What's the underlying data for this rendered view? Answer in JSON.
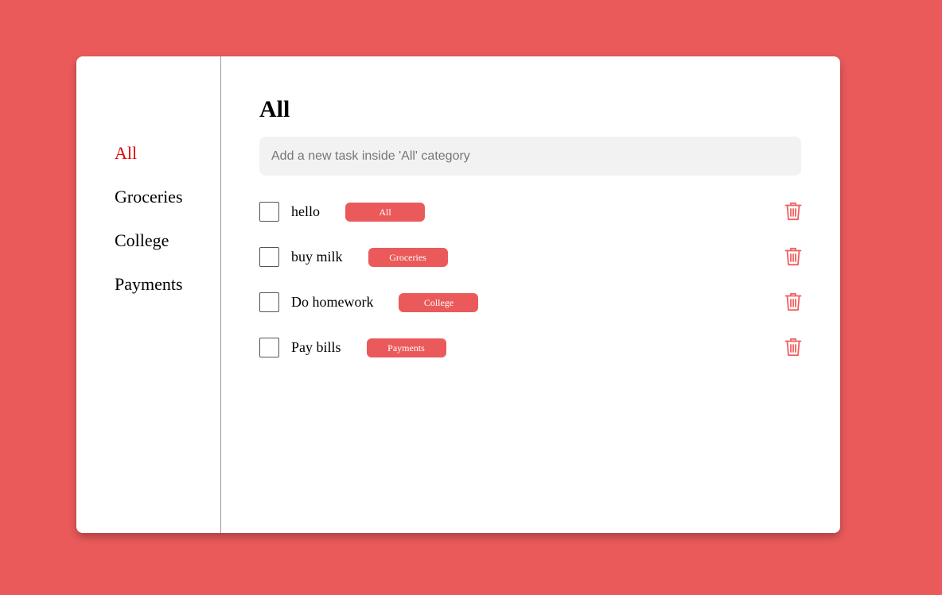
{
  "sidebar": {
    "items": [
      {
        "label": "All"
      },
      {
        "label": "Groceries"
      },
      {
        "label": "College"
      },
      {
        "label": "Payments"
      }
    ]
  },
  "main": {
    "title": "All",
    "input_placeholder": "Add a new task inside 'All' category",
    "tasks": [
      {
        "text": "hello",
        "category": "All"
      },
      {
        "text": "buy milk",
        "category": "Groceries"
      },
      {
        "text": "Do homework",
        "category": "College"
      },
      {
        "text": "Pay bills",
        "category": "Payments"
      }
    ]
  },
  "colors": {
    "background": "#eb5a5a",
    "accent_active": "#e30000",
    "badge": "#eb5a5a",
    "trash_icon": "#f06060"
  },
  "icons": {
    "delete": "trash-icon"
  }
}
